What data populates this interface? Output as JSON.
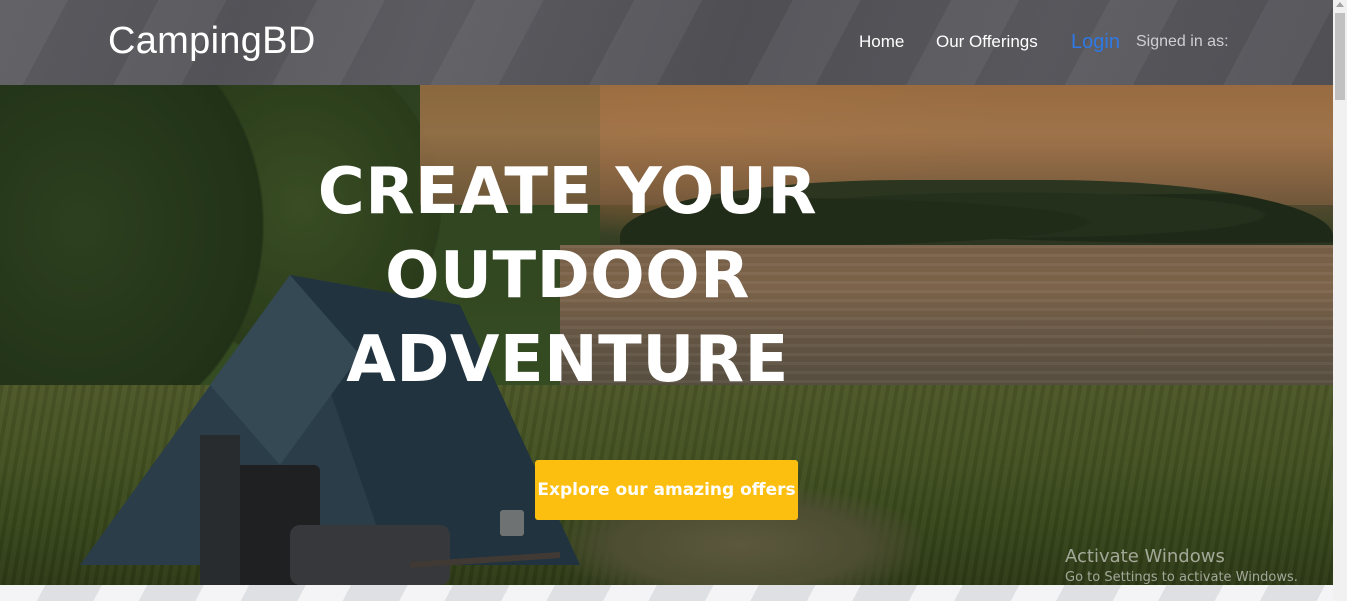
{
  "navbar": {
    "brand": "CampingBD",
    "links": {
      "home": "Home",
      "offerings": "Our Offerings",
      "login": "Login",
      "signed_in": "Signed in as:"
    }
  },
  "hero": {
    "headline_lines": [
      "CREATE YOUR",
      "OUTDOOR",
      "ADVENTURE"
    ],
    "cta_label": "Explore our amazing offers"
  },
  "watermark": {
    "title": "Activate Windows",
    "subtitle": "Go to Settings to activate Windows."
  },
  "colors": {
    "login_link": "#2f79e6",
    "cta_background": "#fdbf0f",
    "navbar_background": "#58585d"
  }
}
